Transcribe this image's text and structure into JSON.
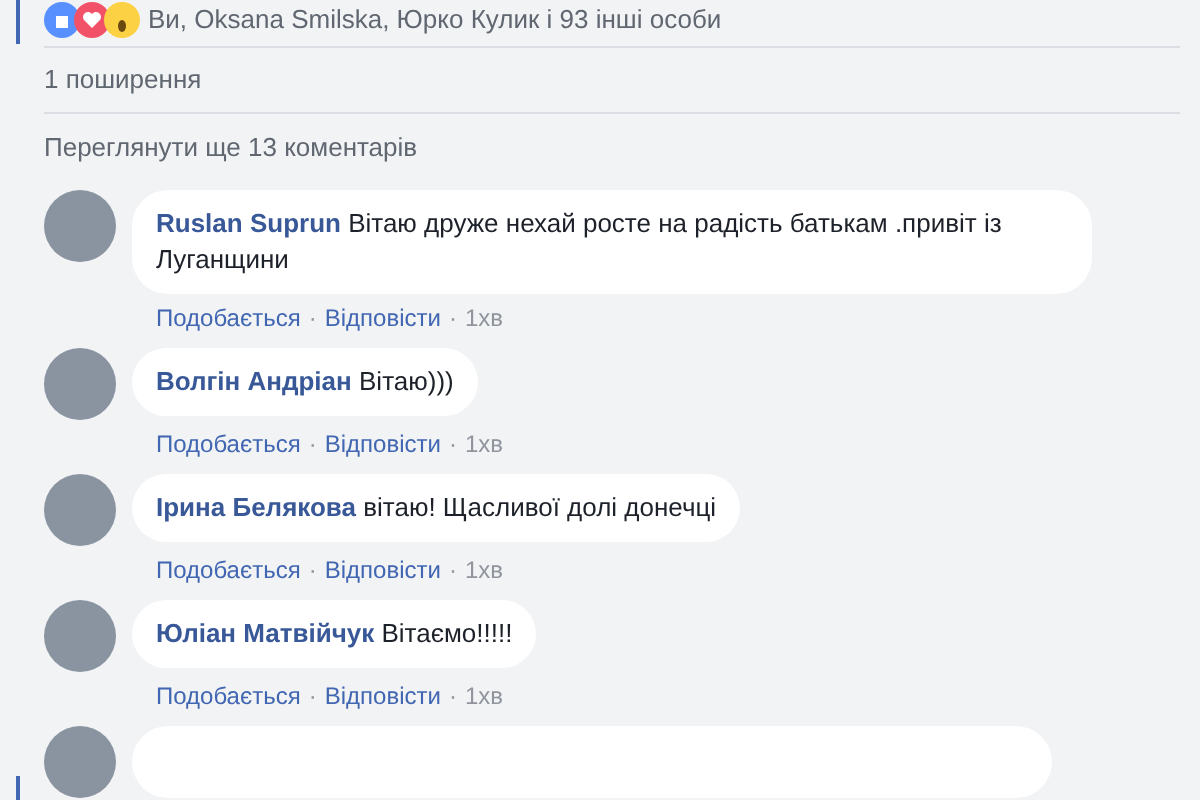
{
  "reactions": {
    "summary": "Ви, Oksana Smilska, Юрко Кулик і 93 інші особи"
  },
  "shares": "1 поширення",
  "more_comments": "Переглянути ще 13 коментарів",
  "comments": [
    {
      "author": "Ruslan Suprun",
      "text": "Вітаю друже нехай росте на радість батькам .привіт із Луганщини",
      "like": "Подобається",
      "reply": "Відповісти",
      "time": "1хв"
    },
    {
      "author": "Волгін Андріан",
      "text": "Вітаю)))",
      "like": "Подобається",
      "reply": "Відповісти",
      "time": "1хв"
    },
    {
      "author": "Ірина Белякова",
      "text": "вітаю! Щасливої долі донечці",
      "like": "Подобається",
      "reply": "Відповісти",
      "time": "1хв"
    },
    {
      "author": "Юліан Матвійчук",
      "text": "Вітаємо!!!!!",
      "like": "Подобається",
      "reply": "Відповісти",
      "time": "1хв"
    }
  ],
  "separator": "·"
}
